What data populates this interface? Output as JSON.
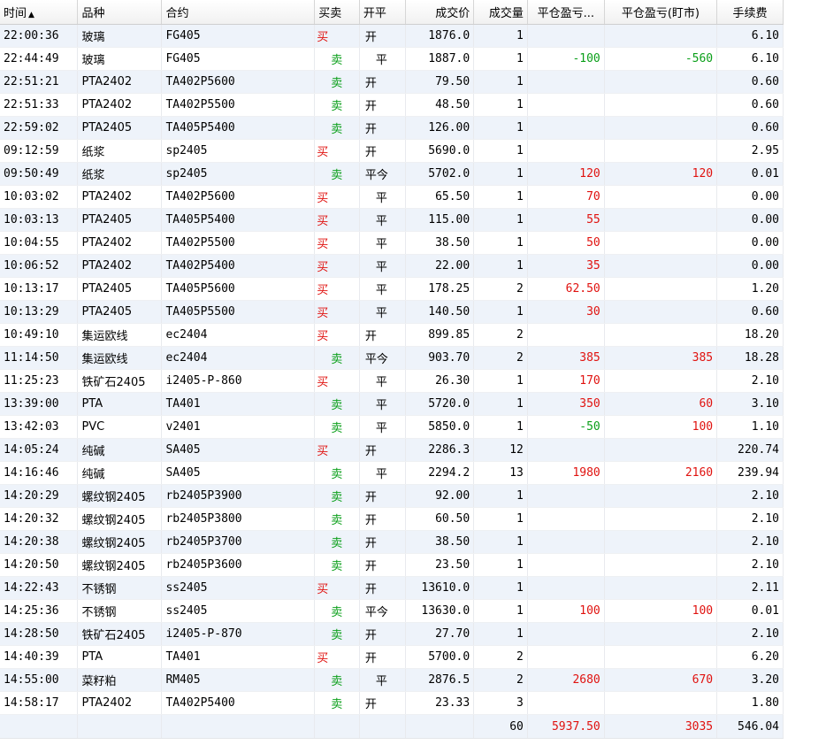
{
  "columns": [
    {
      "label": "时间",
      "sorted": true
    },
    {
      "label": "品种"
    },
    {
      "label": "合约"
    },
    {
      "label": "买卖"
    },
    {
      "label": "开平"
    },
    {
      "label": "成交价"
    },
    {
      "label": "成交量"
    },
    {
      "label": "平仓盈亏..."
    },
    {
      "label": "平仓盈亏(盯市)"
    },
    {
      "label": "手续费"
    }
  ],
  "sort_icon": "sort-ascending-icon",
  "colors": {
    "buy": "#e0120f",
    "sell": "#0a9f19",
    "loss": "#0a9f19",
    "profit": "#e0120f",
    "row_alt": "#eef3fa"
  },
  "rows": [
    {
      "time": "22:00:36",
      "product": "玻璃",
      "contract": "FG405",
      "side": "买",
      "oc": "开",
      "price": "1876.0",
      "qty": "1",
      "pnl": "",
      "pnl_mtm": "",
      "fee": "6.10"
    },
    {
      "time": "22:44:49",
      "product": "玻璃",
      "contract": "FG405",
      "side": "卖",
      "oc": "平",
      "price": "1887.0",
      "qty": "1",
      "pnl": "-100",
      "pnl_mtm": "-560",
      "fee": "6.10"
    },
    {
      "time": "22:51:21",
      "product": "PTA2402",
      "contract": "TA402P5600",
      "side": "卖",
      "oc": "开",
      "price": "79.50",
      "qty": "1",
      "pnl": "",
      "pnl_mtm": "",
      "fee": "0.60"
    },
    {
      "time": "22:51:33",
      "product": "PTA2402",
      "contract": "TA402P5500",
      "side": "卖",
      "oc": "开",
      "price": "48.50",
      "qty": "1",
      "pnl": "",
      "pnl_mtm": "",
      "fee": "0.60"
    },
    {
      "time": "22:59:02",
      "product": "PTA2405",
      "contract": "TA405P5400",
      "side": "卖",
      "oc": "开",
      "price": "126.00",
      "qty": "1",
      "pnl": "",
      "pnl_mtm": "",
      "fee": "0.60"
    },
    {
      "time": "09:12:59",
      "product": "纸浆",
      "contract": "sp2405",
      "side": "买",
      "oc": "开",
      "price": "5690.0",
      "qty": "1",
      "pnl": "",
      "pnl_mtm": "",
      "fee": "2.95"
    },
    {
      "time": "09:50:49",
      "product": "纸浆",
      "contract": "sp2405",
      "side": "卖",
      "oc": "平今",
      "price": "5702.0",
      "qty": "1",
      "pnl": "120",
      "pnl_mtm": "120",
      "fee": "0.01"
    },
    {
      "time": "10:03:02",
      "product": "PTA2402",
      "contract": "TA402P5600",
      "side": "买",
      "oc": "平",
      "price": "65.50",
      "qty": "1",
      "pnl": "70",
      "pnl_mtm": "",
      "fee": "0.00"
    },
    {
      "time": "10:03:13",
      "product": "PTA2405",
      "contract": "TA405P5400",
      "side": "买",
      "oc": "平",
      "price": "115.00",
      "qty": "1",
      "pnl": "55",
      "pnl_mtm": "",
      "fee": "0.00"
    },
    {
      "time": "10:04:55",
      "product": "PTA2402",
      "contract": "TA402P5500",
      "side": "买",
      "oc": "平",
      "price": "38.50",
      "qty": "1",
      "pnl": "50",
      "pnl_mtm": "",
      "fee": "0.00"
    },
    {
      "time": "10:06:52",
      "product": "PTA2402",
      "contract": "TA402P5400",
      "side": "买",
      "oc": "平",
      "price": "22.00",
      "qty": "1",
      "pnl": "35",
      "pnl_mtm": "",
      "fee": "0.00"
    },
    {
      "time": "10:13:17",
      "product": "PTA2405",
      "contract": "TA405P5600",
      "side": "买",
      "oc": "平",
      "price": "178.25",
      "qty": "2",
      "pnl": "62.50",
      "pnl_mtm": "",
      "fee": "1.20"
    },
    {
      "time": "10:13:29",
      "product": "PTA2405",
      "contract": "TA405P5500",
      "side": "买",
      "oc": "平",
      "price": "140.50",
      "qty": "1",
      "pnl": "30",
      "pnl_mtm": "",
      "fee": "0.60"
    },
    {
      "time": "10:49:10",
      "product": "集运欧线",
      "contract": "ec2404",
      "side": "买",
      "oc": "开",
      "price": "899.85",
      "qty": "2",
      "pnl": "",
      "pnl_mtm": "",
      "fee": "18.20"
    },
    {
      "time": "11:14:50",
      "product": "集运欧线",
      "contract": "ec2404",
      "side": "卖",
      "oc": "平今",
      "price": "903.70",
      "qty": "2",
      "pnl": "385",
      "pnl_mtm": "385",
      "fee": "18.28"
    },
    {
      "time": "11:25:23",
      "product": "铁矿石2405",
      "contract": "i2405-P-860",
      "side": "买",
      "oc": "平",
      "price": "26.30",
      "qty": "1",
      "pnl": "170",
      "pnl_mtm": "",
      "fee": "2.10"
    },
    {
      "time": "13:39:00",
      "product": "PTA",
      "contract": "TA401",
      "side": "卖",
      "oc": "平",
      "price": "5720.0",
      "qty": "1",
      "pnl": "350",
      "pnl_mtm": "60",
      "fee": "3.10"
    },
    {
      "time": "13:42:03",
      "product": "PVC",
      "contract": "v2401",
      "side": "卖",
      "oc": "平",
      "price": "5850.0",
      "qty": "1",
      "pnl": "-50",
      "pnl_mtm": "100",
      "fee": "1.10"
    },
    {
      "time": "14:05:24",
      "product": "纯碱",
      "contract": "SA405",
      "side": "买",
      "oc": "开",
      "price": "2286.3",
      "qty": "12",
      "pnl": "",
      "pnl_mtm": "",
      "fee": "220.74"
    },
    {
      "time": "14:16:46",
      "product": "纯碱",
      "contract": "SA405",
      "side": "卖",
      "oc": "平",
      "price": "2294.2",
      "qty": "13",
      "pnl": "1980",
      "pnl_mtm": "2160",
      "fee": "239.94"
    },
    {
      "time": "14:20:29",
      "product": "螺纹钢2405",
      "contract": "rb2405P3900",
      "side": "卖",
      "oc": "开",
      "price": "92.00",
      "qty": "1",
      "pnl": "",
      "pnl_mtm": "",
      "fee": "2.10"
    },
    {
      "time": "14:20:32",
      "product": "螺纹钢2405",
      "contract": "rb2405P3800",
      "side": "卖",
      "oc": "开",
      "price": "60.50",
      "qty": "1",
      "pnl": "",
      "pnl_mtm": "",
      "fee": "2.10"
    },
    {
      "time": "14:20:38",
      "product": "螺纹钢2405",
      "contract": "rb2405P3700",
      "side": "卖",
      "oc": "开",
      "price": "38.50",
      "qty": "1",
      "pnl": "",
      "pnl_mtm": "",
      "fee": "2.10"
    },
    {
      "time": "14:20:50",
      "product": "螺纹钢2405",
      "contract": "rb2405P3600",
      "side": "卖",
      "oc": "开",
      "price": "23.50",
      "qty": "1",
      "pnl": "",
      "pnl_mtm": "",
      "fee": "2.10"
    },
    {
      "time": "14:22:43",
      "product": "不锈钢",
      "contract": "ss2405",
      "side": "买",
      "oc": "开",
      "price": "13610.0",
      "qty": "1",
      "pnl": "",
      "pnl_mtm": "",
      "fee": "2.11"
    },
    {
      "time": "14:25:36",
      "product": "不锈钢",
      "contract": "ss2405",
      "side": "卖",
      "oc": "平今",
      "price": "13630.0",
      "qty": "1",
      "pnl": "100",
      "pnl_mtm": "100",
      "fee": "0.01"
    },
    {
      "time": "14:28:50",
      "product": "铁矿石2405",
      "contract": "i2405-P-870",
      "side": "卖",
      "oc": "开",
      "price": "27.70",
      "qty": "1",
      "pnl": "",
      "pnl_mtm": "",
      "fee": "2.10"
    },
    {
      "time": "14:40:39",
      "product": "PTA",
      "contract": "TA401",
      "side": "买",
      "oc": "开",
      "price": "5700.0",
      "qty": "2",
      "pnl": "",
      "pnl_mtm": "",
      "fee": "6.20"
    },
    {
      "time": "14:55:00",
      "product": "菜籽粕",
      "contract": "RM405",
      "side": "卖",
      "oc": "平",
      "price": "2876.5",
      "qty": "2",
      "pnl": "2680",
      "pnl_mtm": "670",
      "fee": "3.20"
    },
    {
      "time": "14:58:17",
      "product": "PTA2402",
      "contract": "TA402P5400",
      "side": "卖",
      "oc": "开",
      "price": "23.33",
      "qty": "3",
      "pnl": "",
      "pnl_mtm": "",
      "fee": "1.80"
    }
  ],
  "totals": {
    "qty": "60",
    "pnl": "5937.50",
    "pnl_mtm": "3035",
    "fee": "546.04"
  }
}
